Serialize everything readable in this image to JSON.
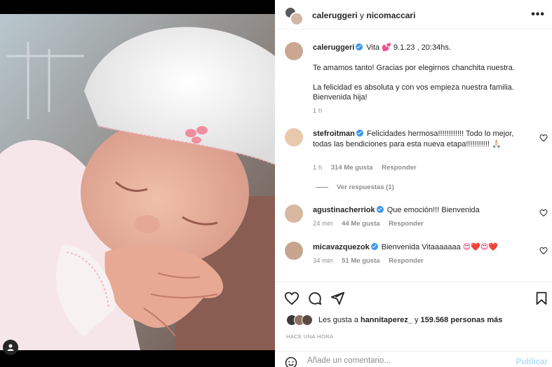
{
  "header": {
    "user1": "caleruggeri",
    "joiner": "y",
    "user2": "nicomaccari",
    "more_icon": "more-horizontal-icon"
  },
  "caption": {
    "username": "caleruggeri",
    "text_line1": "Vita 💕  9.1.23 , 20:34hs.",
    "text_line2": "Te amamos tanto! Gracias por elegirnos chanchita nuestra.",
    "text_line3": "La felicidad es absoluta y con vos empieza nuestra familia.",
    "text_line4": "Bienvenida hija!",
    "time": "1 h"
  },
  "comments": [
    {
      "username": "stefroitman",
      "text": "Felicidades hermosa!!!!!!!!!!!! Todo lo mejor, todas las bendiciones para esta nueva etapa!!!!!!!!!!!",
      "text_emoji": "🙏🏻",
      "time": "1 h",
      "likes": "314 Me gusta",
      "reply": "Responder",
      "view_replies": "Ver respuestas (1)"
    },
    {
      "username": "agustinacherriok",
      "text": "Que emoción!!! Bienvenida",
      "time": "24 min",
      "likes": "44 Me gusta",
      "reply": "Responder"
    },
    {
      "username": "micavazquezok",
      "text": "Bienvenida Vitaaaaaaa",
      "text_emoji": "😍❤️😍❤️",
      "time": "34 min",
      "likes": "51 Me gusta",
      "reply": "Responder"
    }
  ],
  "likes": {
    "prefix": "Les gusta a",
    "user": "hannitaperez_",
    "joiner": "y",
    "count": "159.568 personas más"
  },
  "timestamp": "HACE UNA HORA",
  "add_comment": {
    "placeholder": "Añade un comentario...",
    "publish": "Publicar"
  },
  "colors": {
    "verified": "#3897f0",
    "muted": "#8e8e8e",
    "publish_disabled": "#b2dffc",
    "text": "#262626"
  }
}
